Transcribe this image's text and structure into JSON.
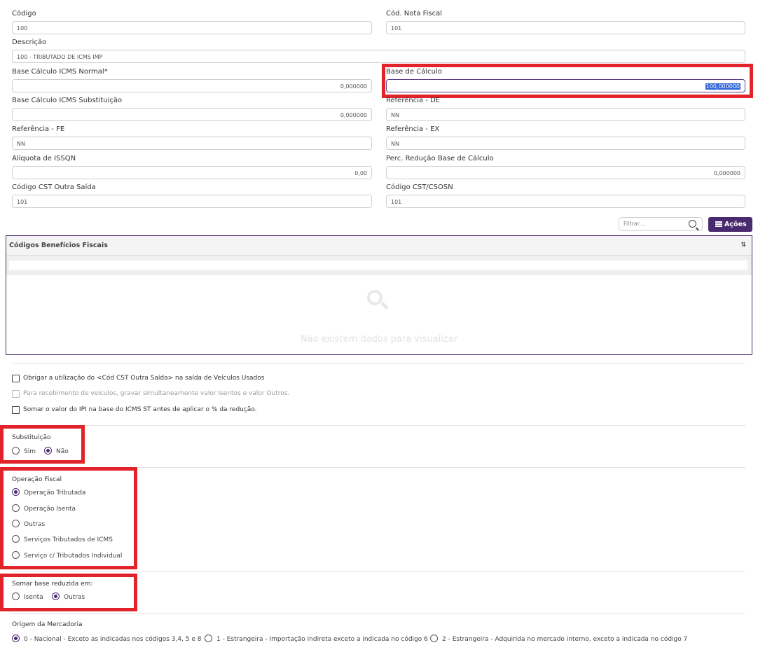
{
  "fields": {
    "codigo": {
      "label": "Código",
      "value": "100"
    },
    "cod_nota_fiscal": {
      "label": "Cód. Nota Fiscal",
      "value": "101"
    },
    "descricao": {
      "label": "Descrição",
      "value": "100 - TRIBUTADO DE ICMS IMP"
    },
    "base_icms_normal": {
      "label": "Base Cálculo ICMS Normal*",
      "value": "0,000000"
    },
    "base_calculo": {
      "label": "Base de Cálculo",
      "value": "100,000000"
    },
    "base_icms_subst": {
      "label": "Base Cálculo ICMS Substituição",
      "value": "0,000000"
    },
    "referencia_de": {
      "label": "Referência - DE",
      "value": "NN"
    },
    "referencia_fe": {
      "label": "Referência - FE",
      "value": "NN"
    },
    "referencia_ex": {
      "label": "Referência - EX",
      "value": "NN"
    },
    "aliquota_issqn": {
      "label": "Alíquota de ISSQN",
      "value": "0,00"
    },
    "perc_reducao": {
      "label": "Perc. Redução Base de Cálculo",
      "value": "0,000000"
    },
    "cst_outra_saida": {
      "label": "Código CST Outra Saída",
      "value": "101"
    },
    "cst_csosn": {
      "label": "Código CST/CSOSN",
      "value": "101"
    }
  },
  "toolbar": {
    "filter_placeholder": "Filtrar...",
    "actions_label": "Ações"
  },
  "grid": {
    "header": "Códigos Benefícios Fiscais",
    "sort_icon": "⇅",
    "empty_text": "Não existem dados para visualizar"
  },
  "checkboxes": [
    {
      "label": "Obrigar a utilização do <Cód CST Outra Saída> na saída de Veículos Usados",
      "checked": false,
      "disabled": false
    },
    {
      "label": "Para recebimento de veículos, gravar simultaneamente valor Isentos e valor Outros.",
      "checked": false,
      "disabled": true
    },
    {
      "label": "Somar o valor do IPI na base do ICMS ST antes de aplicar o % da redução.",
      "checked": false,
      "disabled": false
    }
  ],
  "substituicao": {
    "title": "Substituição",
    "options": [
      "Sim",
      "Não"
    ],
    "selected": "Não"
  },
  "operacao_fiscal": {
    "title": "Operação Fiscal",
    "options": [
      "Operação Tributada",
      "Operação Isenta",
      "Outras",
      "Serviços Tributados de ICMS",
      "Serviço c/ Tributados Individual"
    ],
    "selected": "Operação Tributada"
  },
  "somar_base": {
    "title": "Somar base reduzida em:",
    "options": [
      "Isenta",
      "Outras"
    ],
    "selected": "Outras"
  },
  "origem": {
    "title": "Origem da Mercadoria",
    "options": [
      "0 - Nacional - Exceto as indicadas nos códigos 3,4, 5 e 8",
      "1 - Estrangeira - Importação indireta exceto a indicada no código 6",
      "2 - Estrangeira - Adquirida no mercado interno, exceto a indicada no código 7"
    ],
    "selected": "0 - Nacional - Exceto as indicadas nos códigos 3,4, 5 e 8"
  },
  "colors": {
    "accent": "#4a2a6e",
    "highlight": "#e2232a",
    "selection": "#2f63d6"
  }
}
